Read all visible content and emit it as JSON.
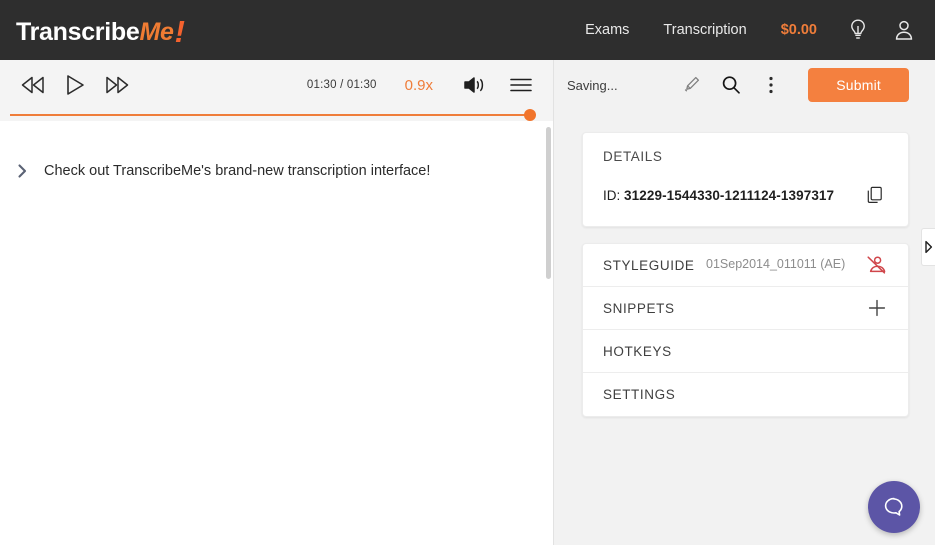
{
  "topnav": {
    "logo": {
      "part1": "Transcribe",
      "part2": "Me",
      "bang": "!"
    },
    "links": [
      {
        "label": "Exams",
        "name": "nav-link-exams"
      },
      {
        "label": "Transcription",
        "name": "nav-link-transcription"
      }
    ],
    "balance": "$0.00",
    "icons": [
      {
        "name": "lightbulb-icon"
      },
      {
        "name": "account-person-icon"
      }
    ],
    "colors": {
      "background": "#2e2e2e",
      "accent": "#ef7d3a",
      "balance": "#ef7d3a"
    }
  },
  "player": {
    "rewind_icon": "rewind-icon",
    "play_icon": "play-icon",
    "forward_icon": "fast-forward-icon",
    "time": "01:30 / 01:30",
    "speed": "0.9x",
    "volume_icon": "volume-icon",
    "menu_icon": "hamburger-menu-icon",
    "progress_percent": 100,
    "accent_color": "#ef7d3a"
  },
  "transcript": {
    "lines": [
      {
        "marker": "chevron-right-icon",
        "text": "Check out TranscribeMe's brand-new transcription interface!"
      }
    ]
  },
  "editor_toolbar": {
    "status": "Saving...",
    "icons": [
      {
        "name": "highlighter-icon"
      },
      {
        "name": "search-icon"
      },
      {
        "name": "more-vertical-icon"
      }
    ],
    "submit_label": "Submit",
    "submit_color": "#f4803f"
  },
  "details_card": {
    "title": "DETAILS",
    "id_label": "ID:",
    "id_value": "31229-1544330-1211124-1397317",
    "copy_icon": "copy-icon"
  },
  "menu_card": {
    "rows": [
      {
        "label": "STYLEGUIDE",
        "value": "01Sep2014_011011 (AE)",
        "action_icon": "styleguide-disabled-icon",
        "action_color": "#d0464b"
      },
      {
        "label": "SNIPPETS",
        "value": "",
        "action_icon": "plus-icon",
        "action_color": "#444444"
      },
      {
        "label": "HOTKEYS",
        "value": "",
        "action_icon": "",
        "action_color": ""
      },
      {
        "label": "SETTINGS",
        "value": "",
        "action_icon": "",
        "action_color": ""
      }
    ]
  },
  "panel_handle": {
    "icon": "chevron-right-icon"
  },
  "help_fab": {
    "icon": "chat-bubble-icon",
    "color": "#5c55a6"
  }
}
